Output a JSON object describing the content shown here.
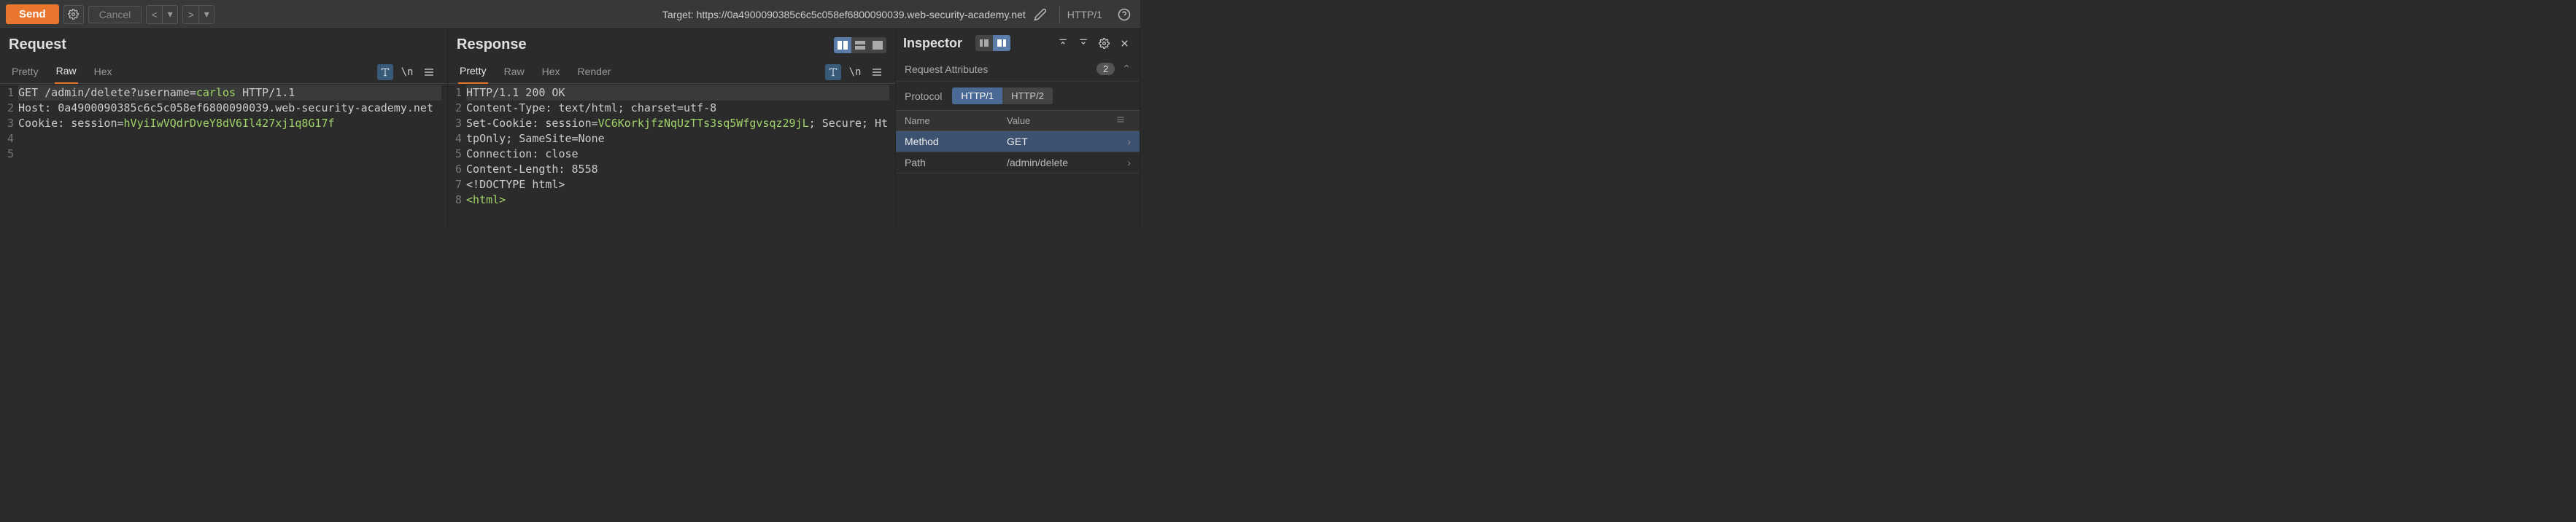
{
  "toolbar": {
    "send": "Send",
    "cancel": "Cancel",
    "target_label": "Target: ",
    "target_url": "https://0a4900090385c6c5c058ef6800090039.web-security-academy.net",
    "http_version": "HTTP/1"
  },
  "request": {
    "title": "Request",
    "tabs": [
      "Pretty",
      "Raw",
      "Hex"
    ],
    "active_tab": "Raw",
    "lines": [
      {
        "n": 1,
        "segs": [
          {
            "t": "GET /admin/delete?username=",
            "c": ""
          },
          {
            "t": "carlos",
            "c": "param"
          },
          {
            "t": " HTTP/1.1",
            "c": ""
          }
        ],
        "hl": true
      },
      {
        "n": 2,
        "segs": [
          {
            "t": "Host: 0a4900090385c6c5c058ef6800090039.web-security-academy.net",
            "c": ""
          }
        ]
      },
      {
        "n": 3,
        "segs": [
          {
            "t": "Cookie: session=",
            "c": ""
          },
          {
            "t": "hVyiIwVQdrDveY8dV6Il427xj1q8G17f",
            "c": "str"
          }
        ]
      },
      {
        "n": 4,
        "segs": [
          {
            "t": "",
            "c": ""
          }
        ]
      },
      {
        "n": 5,
        "segs": [
          {
            "t": "",
            "c": ""
          }
        ]
      }
    ]
  },
  "response": {
    "title": "Response",
    "tabs": [
      "Pretty",
      "Raw",
      "Hex",
      "Render"
    ],
    "active_tab": "Pretty",
    "lines": [
      {
        "n": 1,
        "segs": [
          {
            "t": "HTTP/1.1 200 OK",
            "c": ""
          }
        ],
        "hl": true
      },
      {
        "n": 2,
        "segs": [
          {
            "t": "Content-Type: text/html; charset=utf-8",
            "c": ""
          }
        ]
      },
      {
        "n": 3,
        "segs": [
          {
            "t": "Set-Cookie: session=",
            "c": ""
          },
          {
            "t": "VC6KorkjfzNqUzTTs3sq5Wfgvsqz29jL",
            "c": "str"
          },
          {
            "t": "; Secure; HttpOnly; SameSite=None",
            "c": ""
          }
        ]
      },
      {
        "n": 4,
        "segs": [
          {
            "t": "Connection: close",
            "c": ""
          }
        ]
      },
      {
        "n": 5,
        "segs": [
          {
            "t": "Content-Length: 8558",
            "c": ""
          }
        ]
      },
      {
        "n": 6,
        "segs": [
          {
            "t": "",
            "c": ""
          }
        ]
      },
      {
        "n": 7,
        "segs": [
          {
            "t": "<!DOCTYPE html>",
            "c": ""
          }
        ]
      },
      {
        "n": 8,
        "segs": [
          {
            "t": "<html>",
            "c": "str"
          }
        ]
      }
    ]
  },
  "inspector": {
    "title": "Inspector",
    "attrs_label": "Request Attributes",
    "attrs_count": "2",
    "protocol_label": "Protocol",
    "protocols": [
      "HTTP/1",
      "HTTP/2"
    ],
    "protocol_active": "HTTP/1",
    "columns": {
      "name": "Name",
      "value": "Value"
    },
    "rows": [
      {
        "name": "Method",
        "value": "GET",
        "selected": true
      },
      {
        "name": "Path",
        "value": "/admin/delete",
        "selected": false
      }
    ]
  }
}
